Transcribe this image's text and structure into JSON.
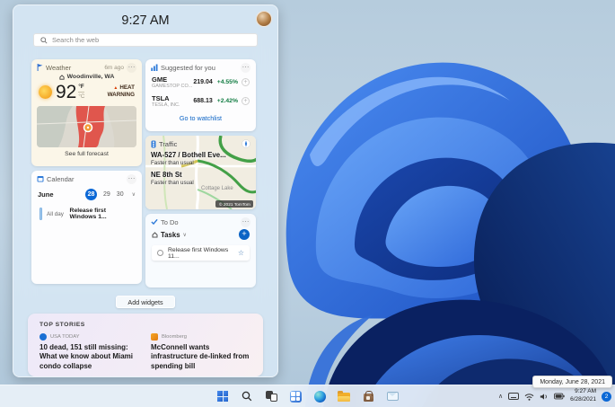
{
  "colors": {
    "accent": "#0067c0",
    "positive_change": "#0f7b40",
    "alert_red": "#d83b01",
    "selected_day_bg": "#0b68d6",
    "bloom_primary": "#2b6be0",
    "bloom_dark": "#0a2161"
  },
  "panel": {
    "clock": "9:27 AM",
    "search_placeholder": "Search the web",
    "weather": {
      "title": "Weather",
      "updated": "6m ago",
      "location": "Woodinville, WA",
      "temperature": "92",
      "unit_primary": "°F",
      "unit_secondary": "°C",
      "alert_top": "HEAT",
      "alert_bottom": "WARNING",
      "footer_link": "See full forecast"
    },
    "stocks": {
      "title": "Suggested for you",
      "rows": [
        {
          "symbol": "GME",
          "company": "GAMESTOP CO...",
          "price": "219.04",
          "change": "+4.55%"
        },
        {
          "symbol": "TSLA",
          "company": "TESLA, INC.",
          "price": "688.13",
          "change": "+2.42%"
        }
      ],
      "footer_link": "Go to watchlist"
    },
    "traffic": {
      "title": "Traffic",
      "route1_name": "WA-527 / Bothell Eve...",
      "route1_status": "Faster than usual",
      "route2_name": "NE 8th St",
      "route2_status": "Faster than usual",
      "map_label": "Cottage Lake",
      "attribution": "© 2021 TomTom"
    },
    "calendar": {
      "title": "Calendar",
      "month": "June",
      "day_selected": "28",
      "day2": "29",
      "day3": "30",
      "event_time": "All day",
      "event_title": "Release first Windows 1..."
    },
    "todo": {
      "title": "To Do",
      "list_label": "Tasks",
      "task_title": "Release first Windows 11..."
    },
    "add_widgets_label": "Add widgets",
    "news": {
      "section_label": "TOP STORIES",
      "stories": [
        {
          "source": "USA TODAY",
          "headline": "10 dead, 151 still missing: What we know about Miami condo collapse"
        },
        {
          "source": "Bloomberg",
          "headline": "McConnell wants infrastructure de-linked from spending bill"
        }
      ]
    }
  },
  "taskbar": {
    "icons": [
      "start",
      "search",
      "task-view",
      "widgets",
      "edge",
      "file-explorer",
      "store",
      "mail"
    ],
    "tray_time": "9:27 AM",
    "tray_date": "6/28/2021",
    "notification_count": "2",
    "date_tooltip": "Monday, June 28, 2021"
  }
}
